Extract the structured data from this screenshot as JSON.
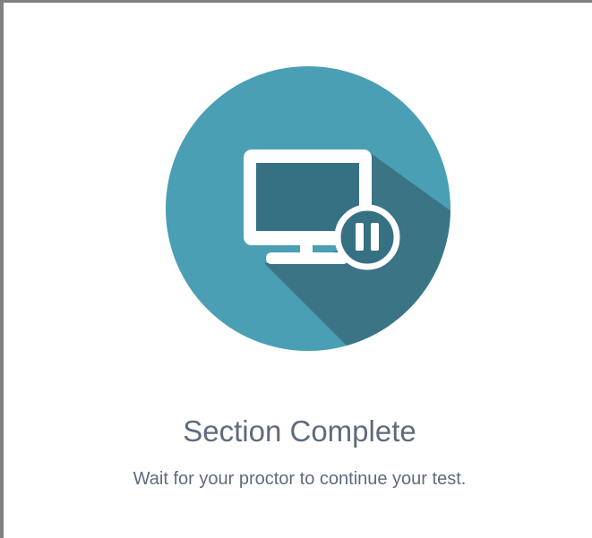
{
  "status": {
    "title": "Section Complete",
    "message": "Wait for your proctor to continue your test."
  },
  "illustration": {
    "icon": "monitor-paused-icon",
    "colors": {
      "circle": "#4a9fb5",
      "shadow": "#3a7485",
      "screen": "#357182",
      "frame": "#ffffff"
    }
  }
}
